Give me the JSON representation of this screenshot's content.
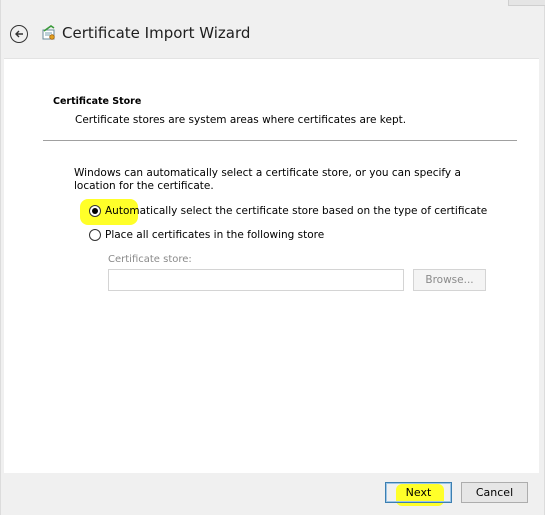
{
  "window": {
    "title": "Certificate Import Wizard",
    "back_icon": "back-arrow-icon",
    "wizard_icon": "certificate-icon"
  },
  "page": {
    "section_title": "Certificate Store",
    "section_description": "Certificate stores are system areas where certificates are kept.",
    "intro_text": "Windows can automatically select a certificate store, or you can specify a location for the certificate."
  },
  "options": [
    {
      "label": "Automatically select the certificate store based on the type of certificate",
      "selected": true
    },
    {
      "label": "Place all certificates in the following store",
      "selected": false
    }
  ],
  "store": {
    "label": "Certificate store:",
    "value": "",
    "browse_label": "Browse...",
    "enabled": false
  },
  "footer": {
    "next_label": "Next",
    "cancel_label": "Cancel"
  },
  "colors": {
    "highlight": "#ffff29",
    "next_border": "#3c7fb1"
  }
}
